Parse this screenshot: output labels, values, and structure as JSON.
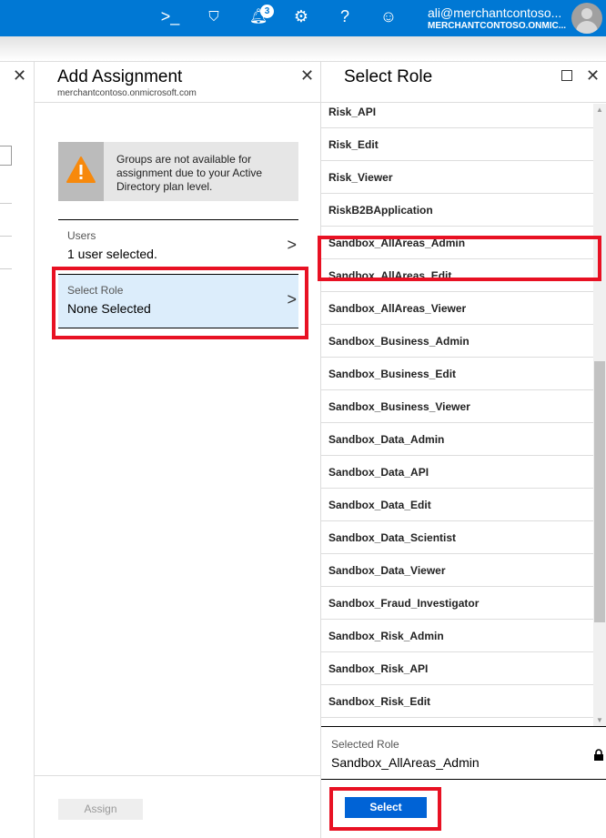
{
  "topbar": {
    "notification_count": "3",
    "user_email": "ali@merchantcontoso...",
    "tenant": "MERCHANTCONTOSO.ONMIC...",
    "accent": "#0078d4"
  },
  "add_assignment": {
    "title": "Add Assignment",
    "subtitle": "merchantcontoso.onmicrosoft.com",
    "warning": "Groups are not available for assignment due to your Active Directory plan level.",
    "users_label": "Users",
    "users_value": "1 user selected.",
    "role_label": "Select Role",
    "role_value": "None Selected",
    "assign_label": "Assign"
  },
  "select_role": {
    "title": "Select Role",
    "roles": [
      "Risk_API",
      "Risk_Edit",
      "Risk_Viewer",
      "RiskB2BApplication",
      "Sandbox_AllAreas_Admin",
      "Sandbox_AllAreas_Edit",
      "Sandbox_AllAreas_Viewer",
      "Sandbox_Business_Admin",
      "Sandbox_Business_Edit",
      "Sandbox_Business_Viewer",
      "Sandbox_Data_Admin",
      "Sandbox_Data_API",
      "Sandbox_Data_Edit",
      "Sandbox_Data_Scientist",
      "Sandbox_Data_Viewer",
      "Sandbox_Fraud_Investigator",
      "Sandbox_Risk_Admin",
      "Sandbox_Risk_API",
      "Sandbox_Risk_Edit"
    ],
    "selected_index": 4,
    "selected_label": "Selected Role",
    "selected_value": "Sandbox_AllAreas_Admin",
    "select_button": "Select"
  }
}
